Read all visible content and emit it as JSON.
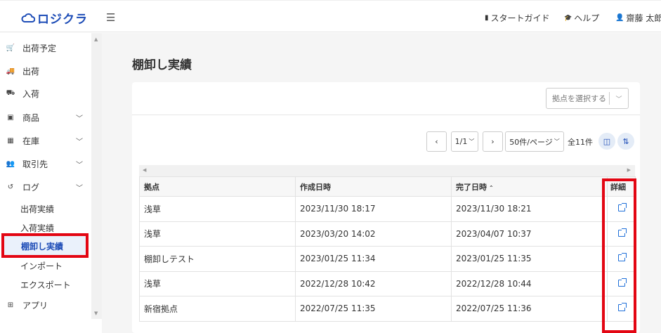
{
  "header": {
    "logo_text": "ロジクラ",
    "start_guide": "スタートガイド",
    "help": "ヘルプ",
    "user": "齋藤 太郎"
  },
  "sidebar": {
    "items": [
      {
        "label": "出荷予定",
        "icon": "cart-icon"
      },
      {
        "label": "出荷",
        "icon": "truck-icon"
      },
      {
        "label": "入荷",
        "icon": "dolly-icon"
      },
      {
        "label": "商品",
        "icon": "box-icon",
        "expandable": true
      },
      {
        "label": "在庫",
        "icon": "boxes-icon",
        "expandable": true
      },
      {
        "label": "取引先",
        "icon": "users-icon",
        "expandable": true
      },
      {
        "label": "ログ",
        "icon": "history-icon",
        "expandable": true
      }
    ],
    "log_sub": [
      "出荷実績",
      "入荷実績",
      "棚卸し実績",
      "インポート",
      "エクスポート"
    ],
    "app": {
      "label": "アプリ",
      "icon": "plus-square-icon"
    }
  },
  "main": {
    "title": "棚卸し実績",
    "location_placeholder": "拠点を選択する",
    "pagination": {
      "page": "1/1",
      "per_page": "50件/ページ",
      "total": "全11件"
    },
    "table": {
      "headers": [
        "拠点",
        "作成日時",
        "完了日時",
        "詳細"
      ],
      "rows": [
        [
          "浅草",
          "2023/11/30 18:17",
          "2023/11/30 18:21"
        ],
        [
          "浅草",
          "2023/03/20 14:02",
          "2023/04/07 10:37"
        ],
        [
          "棚卸しテスト",
          "2023/01/25 11:34",
          "2023/01/25 11:35"
        ],
        [
          "浅草",
          "2022/12/28 10:42",
          "2022/12/28 10:44"
        ],
        [
          "新宿拠点",
          "2022/07/25 11:35",
          "2022/07/25 11:36"
        ]
      ]
    }
  },
  "colors": {
    "accent": "#1e4db7",
    "highlight": "#e30613",
    "link": "#1e6fd9"
  }
}
